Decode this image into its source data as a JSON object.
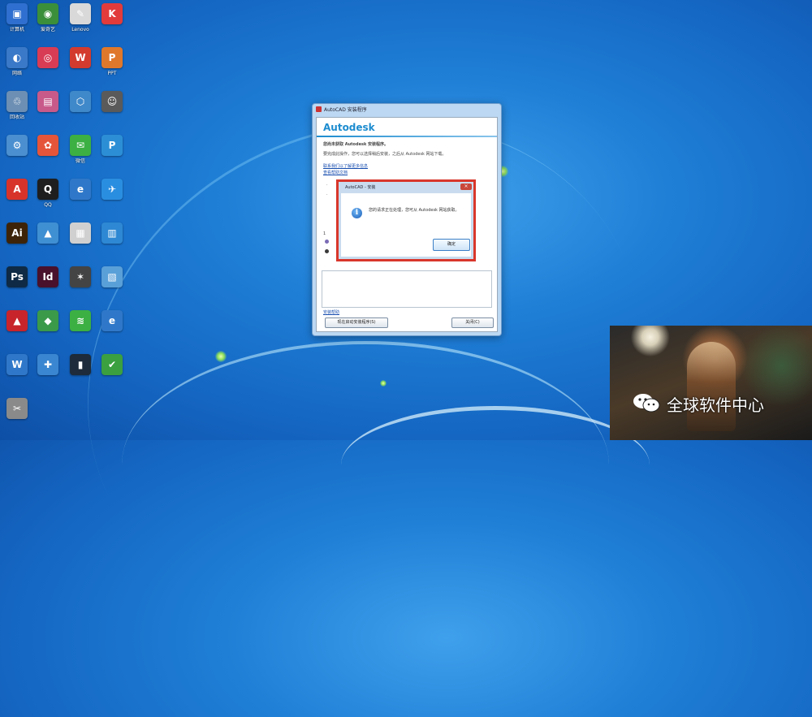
{
  "desktop_icons": [
    {
      "name": "desktop-icon-computer",
      "label": "计算机",
      "glyph": "▣",
      "color": "#2f6fcf"
    },
    {
      "name": "desktop-icon-aiqiyi",
      "label": "爱奇艺",
      "glyph": "◉",
      "color": "#3b8f3b"
    },
    {
      "name": "desktop-icon-lenovo",
      "label": "Lenovo",
      "glyph": "✎",
      "color": "#d9d9d9"
    },
    {
      "name": "desktop-icon-kingsoft",
      "label": "",
      "glyph": "K",
      "color": "#e23b3b"
    },
    {
      "name": "desktop-icon-network",
      "label": "网络",
      "glyph": "◐",
      "color": "#3a78c8"
    },
    {
      "name": "desktop-icon-app-red",
      "label": "",
      "glyph": "◎",
      "color": "#d83c55"
    },
    {
      "name": "desktop-icon-wps",
      "label": "",
      "glyph": "W",
      "color": "#d33b2f"
    },
    {
      "name": "desktop-icon-ppt",
      "label": "PPT",
      "glyph": "P",
      "color": "#e0782c"
    },
    {
      "name": "desktop-icon-recycle-bin",
      "label": "回收站",
      "glyph": "♲",
      "color": "#6d8fb3"
    },
    {
      "name": "desktop-icon-photo-app",
      "label": "",
      "glyph": "▤",
      "color": "#c85a8a"
    },
    {
      "name": "desktop-icon-tool-blue",
      "label": "",
      "glyph": "⬡",
      "color": "#3f88c9"
    },
    {
      "name": "desktop-icon-people",
      "label": "",
      "glyph": "☺",
      "color": "#5a5a5a"
    },
    {
      "name": "desktop-icon-control",
      "label": "",
      "glyph": "⚙",
      "color": "#4b8fd0"
    },
    {
      "name": "desktop-icon-game",
      "label": "",
      "glyph": "✿",
      "color": "#e5553a"
    },
    {
      "name": "desktop-icon-wechat",
      "label": "微信",
      "glyph": "✉",
      "color": "#3cb043"
    },
    {
      "name": "desktop-icon-search-app",
      "label": "",
      "glyph": "P",
      "color": "#2c8fd6"
    },
    {
      "name": "desktop-icon-pdf",
      "label": "",
      "glyph": "A",
      "color": "#d8332b"
    },
    {
      "name": "desktop-icon-qq",
      "label": "QQ",
      "glyph": "Q",
      "color": "#1e1e1e"
    },
    {
      "name": "desktop-icon-ie",
      "label": "",
      "glyph": "e",
      "color": "#2f78c9"
    },
    {
      "name": "desktop-icon-xunlei",
      "label": "",
      "glyph": "✈",
      "color": "#2a8ee0"
    },
    {
      "name": "desktop-icon-illustrator",
      "label": "",
      "glyph": "Ai",
      "color": "#3d2408"
    },
    {
      "name": "desktop-icon-maps",
      "label": "",
      "glyph": "▲",
      "color": "#3f8fd3"
    },
    {
      "name": "desktop-icon-doc",
      "label": "",
      "glyph": "▦",
      "color": "#d0d0d0"
    },
    {
      "name": "desktop-icon-store",
      "label": "",
      "glyph": "▥",
      "color": "#2e88d3"
    },
    {
      "name": "desktop-icon-photoshop",
      "label": "",
      "glyph": "Ps",
      "color": "#0e2a45"
    },
    {
      "name": "desktop-icon-indesign",
      "label": "",
      "glyph": "Id",
      "color": "#49112b"
    },
    {
      "name": "desktop-icon-wolfram",
      "label": "",
      "glyph": "✶",
      "color": "#444"
    },
    {
      "name": "desktop-icon-file",
      "label": "",
      "glyph": "▧",
      "color": "#5aa0d8"
    },
    {
      "name": "desktop-icon-acrobat",
      "label": "",
      "glyph": "▲",
      "color": "#c8242b"
    },
    {
      "name": "desktop-icon-sketchup",
      "label": "",
      "glyph": "◆",
      "color": "#3a9a4a"
    },
    {
      "name": "desktop-icon-spotify",
      "label": "",
      "glyph": "≋",
      "color": "#3cb043"
    },
    {
      "name": "desktop-icon-ie2",
      "label": "",
      "glyph": "e",
      "color": "#2f78c9"
    },
    {
      "name": "desktop-icon-wordpad",
      "label": "",
      "glyph": "W",
      "color": "#2f78c9"
    },
    {
      "name": "desktop-icon-app-blue",
      "label": "",
      "glyph": "✚",
      "color": "#3b86d0"
    },
    {
      "name": "desktop-icon-terminal",
      "label": "",
      "glyph": "▮",
      "color": "#1d2b3a"
    },
    {
      "name": "desktop-icon-check",
      "label": "",
      "glyph": "✔",
      "color": "#3aa040"
    },
    {
      "name": "desktop-icon-tools",
      "label": "",
      "glyph": "✂",
      "color": "#8a8a8a"
    }
  ],
  "installer": {
    "title": "AutoCAD 安装程序",
    "brand": "Autodesk",
    "heading": "您尚未获取 Autodesk 安装程序。",
    "paragraph": "要完成此操作，您可以选择稍后安装，之后从 Autodesk 网站下载。",
    "link1": "联系我们以了解更多信息",
    "link2": "查看帮助文档",
    "bullet1": "·",
    "bullet2": "·",
    "section_label": "1",
    "help_link": "安装帮助",
    "left_button": "现在启动安装程序(S)",
    "right_button": "关闭(C)"
  },
  "message_box": {
    "title": "AutoCAD - 安装",
    "close_label": "×",
    "icon_glyph": "i",
    "message": "您的请求正在处理，您可从 Autodesk 网站获取。",
    "ok_label": "确定"
  },
  "watermark": {
    "text": "全球软件中心"
  }
}
